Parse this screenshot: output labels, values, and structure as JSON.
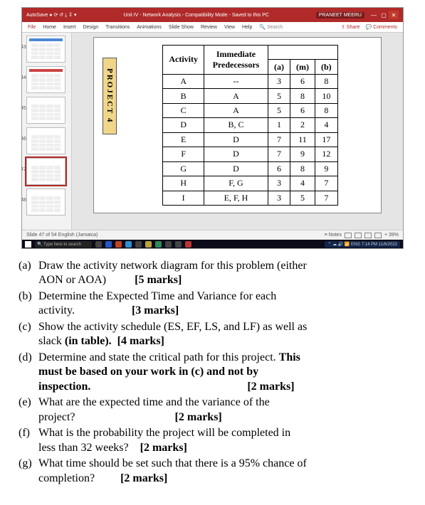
{
  "titlebar": {
    "left": "AutoSave ● ⟳ ↺ ⤓ ↧ ▾",
    "center": "Unit IV - Network Analysis - Compatibility Mode - Saved to this PC",
    "user": "PRANEET MEERU",
    "min": "—",
    "max": "▢",
    "close": "✕"
  },
  "ribbon": {
    "file": "File",
    "home": "Home",
    "insert": "Insert",
    "design": "Design",
    "transitions": "Transitions",
    "animations": "Animations",
    "slideshow": "Slide Show",
    "review": "Review",
    "view": "View",
    "help": "Help",
    "search": "🔍 Search",
    "share": "⇪ Share",
    "comments": "💬 Comments"
  },
  "thumb_nums": {
    "t1": "43",
    "t2": "44",
    "t3": "45",
    "t4": "46",
    "t5": "47",
    "t6": "48"
  },
  "project_label": "PROJECT 4",
  "headers": {
    "activity": "Activity",
    "pred": "Immediate Predecessors",
    "a": "(a)",
    "m": "(m)",
    "b": "(b)"
  },
  "rows": [
    {
      "act": "A",
      "pred": "--",
      "a": "3",
      "m": "6",
      "b": "8"
    },
    {
      "act": "B",
      "pred": "A",
      "a": "5",
      "m": "8",
      "b": "10"
    },
    {
      "act": "C",
      "pred": "A",
      "a": "5",
      "m": "6",
      "b": "8"
    },
    {
      "act": "D",
      "pred": "B, C",
      "a": "1",
      "m": "2",
      "b": "4"
    },
    {
      "act": "E",
      "pred": "D",
      "a": "7",
      "m": "11",
      "b": "17"
    },
    {
      "act": "F",
      "pred": "D",
      "a": "7",
      "m": "9",
      "b": "12"
    },
    {
      "act": "G",
      "pred": "D",
      "a": "6",
      "m": "8",
      "b": "9"
    },
    {
      "act": "H",
      "pred": "F, G",
      "a": "3",
      "m": "4",
      "b": "7"
    },
    {
      "act": "I",
      "pred": "E, F, H",
      "a": "3",
      "m": "5",
      "b": "7"
    }
  ],
  "status": {
    "left": "Slide 47 of 54   English (Jamaica)",
    "notes": "≡ Notes",
    "zoom": "+ 39%"
  },
  "taskbar": {
    "search": "🔍 Type here to search",
    "tray": "⌃ ☁ 🔊 📶 ENG  7:14 PM  11/6/2022"
  },
  "q": {
    "a_label": "(a)",
    "a_body1": "Draw the activity network diagram for this problem (either",
    "a_body2": "AON or AOA)",
    "a_marks": "[5 marks]",
    "b_label": "(b)",
    "b_body1": "Determine the Expected Time and Variance for each",
    "b_body2": "activity.",
    "b_marks": "[3 marks]",
    "c_label": "(c)",
    "c_body1": "Show the activity schedule (ES, EF, LS, and LF) as well as",
    "c_body2_pre": "slack ",
    "c_body2_bold": "(in table).",
    "c_marks": "[4 marks]",
    "d_label": "(d)",
    "d_body1_pre": "Determine and state the critical path for this project.  ",
    "d_body1_bold": "This",
    "d_body2_bold": "must be based on your work in (c) and not by",
    "d_body3_bold": "inspection.",
    "d_marks": "[2 marks]",
    "e_label": "(e)",
    "e_body1": "What are the expected time and the variance of the",
    "e_body2": "project?",
    "e_marks": "[2 marks]",
    "f_label": "(f)",
    "f_body1": "What is the probability the project will be completed in",
    "f_body2": "less than 32 weeks?",
    "f_marks": "[2 marks]",
    "g_label": "(g)",
    "g_body1": "What time should be set such that there is a 95% chance of",
    "g_body2": "completion?",
    "g_marks": "[2 marks]"
  },
  "chart_data": {
    "type": "table",
    "title": "PROJECT 4 — PERT activity estimates",
    "columns": [
      "Activity",
      "Immediate Predecessors",
      "(a)",
      "(m)",
      "(b)"
    ],
    "rows": [
      [
        "A",
        "--",
        3,
        6,
        8
      ],
      [
        "B",
        "A",
        5,
        8,
        10
      ],
      [
        "C",
        "A",
        5,
        6,
        8
      ],
      [
        "D",
        "B, C",
        1,
        2,
        4
      ],
      [
        "E",
        "D",
        7,
        11,
        17
      ],
      [
        "F",
        "D",
        7,
        9,
        12
      ],
      [
        "G",
        "D",
        6,
        8,
        9
      ],
      [
        "H",
        "F, G",
        3,
        4,
        7
      ],
      [
        "I",
        "E, F, H",
        3,
        5,
        7
      ]
    ]
  }
}
